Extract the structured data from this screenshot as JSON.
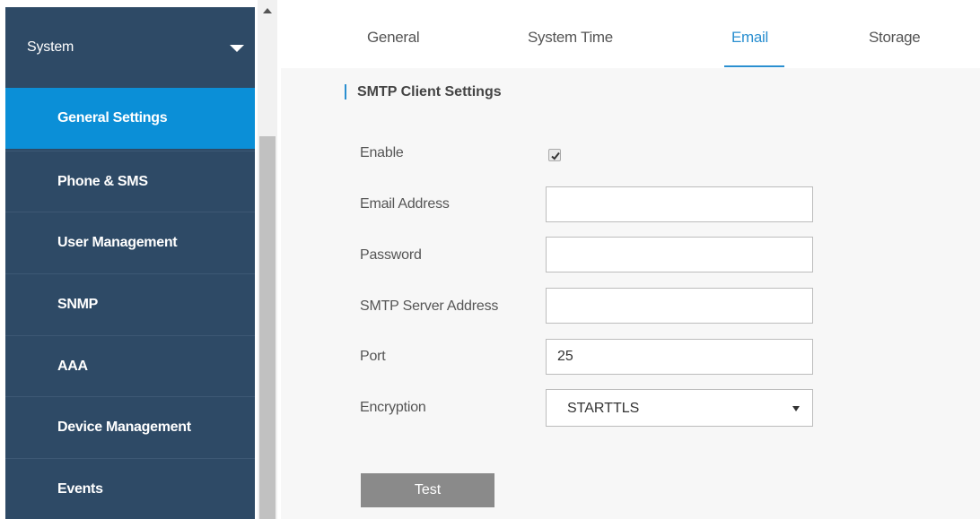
{
  "sidebar": {
    "header": "System",
    "items": [
      {
        "label": "General Settings",
        "active": true
      },
      {
        "label": "Phone & SMS",
        "active": false
      },
      {
        "label": "User Management",
        "active": false
      },
      {
        "label": "SNMP",
        "active": false
      },
      {
        "label": "AAA",
        "active": false
      },
      {
        "label": "Device Management",
        "active": false
      },
      {
        "label": "Events",
        "active": false
      }
    ]
  },
  "tabs": [
    {
      "label": "General",
      "active": false
    },
    {
      "label": "System Time",
      "active": false
    },
    {
      "label": "Email",
      "active": true
    },
    {
      "label": "Storage",
      "active": false
    }
  ],
  "section": {
    "title": "SMTP Client Settings"
  },
  "form": {
    "enable": {
      "label": "Enable",
      "checked": true
    },
    "email": {
      "label": "Email Address",
      "value": ""
    },
    "password": {
      "label": "Password",
      "value": ""
    },
    "smtp_server": {
      "label": "SMTP Server Address",
      "value": ""
    },
    "port": {
      "label": "Port",
      "value": "25"
    },
    "encryption": {
      "label": "Encryption",
      "value": "STARTTLS"
    }
  },
  "actions": {
    "test_label": "Test"
  },
  "colors": {
    "sidebar": "#2e4a66",
    "active_item": "#0b8fd7",
    "accent": "#2a8fd0",
    "button": "#8a8a8a"
  }
}
